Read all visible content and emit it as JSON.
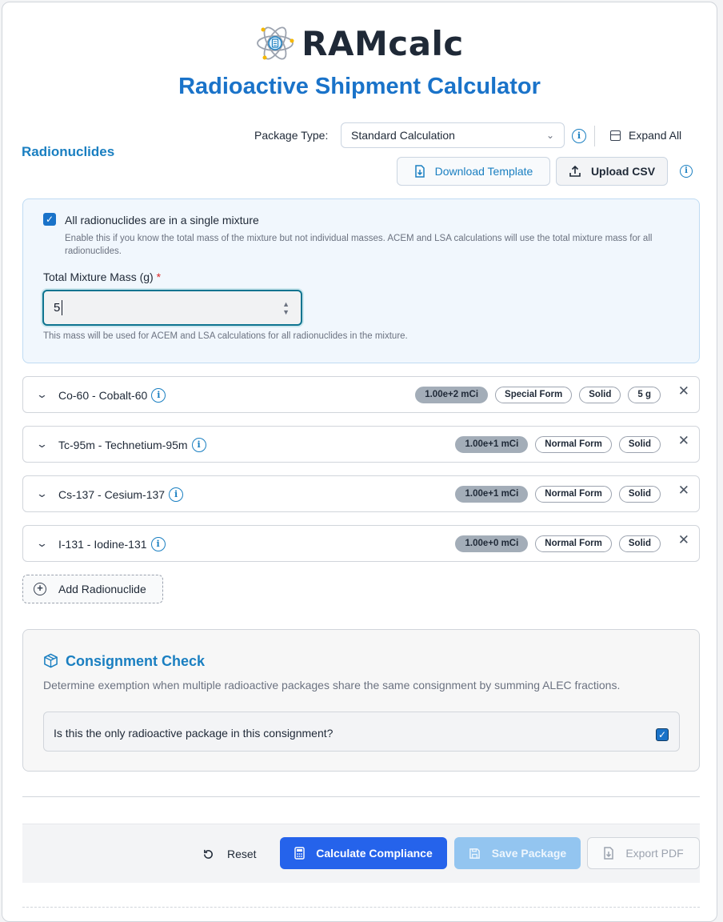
{
  "header": {
    "logo_text": "RAMcalc",
    "title": "Radioactive Shipment Calculator"
  },
  "radionuclides": {
    "section_title": "Radionuclides",
    "package_type_label": "Package Type:",
    "package_type_value": "Standard Calculation",
    "expand_all_label": "Expand All",
    "download_template_label": "Download Template",
    "upload_csv_label": "Upload CSV"
  },
  "mixture": {
    "checked": true,
    "checkbox_label": "All radionuclides are in a single mixture",
    "help": "Enable this if you know the total mass of the mixture but not individual masses. ACEM and LSA calculations will use the total mixture mass for all radionuclides.",
    "mass_label": "Total Mixture Mass (g)",
    "required_mark": "*",
    "mass_value": "5",
    "mass_help": "This mass will be used for ACEM and LSA calculations for all radionuclides in the mixture."
  },
  "nuclides": [
    {
      "name": "Co-60 - Cobalt-60",
      "activity": "1.00e+2 mCi",
      "form": "Special Form",
      "state": "Solid",
      "mass": "5 g"
    },
    {
      "name": "Tc-95m - Technetium-95m",
      "activity": "1.00e+1 mCi",
      "form": "Normal Form",
      "state": "Solid"
    },
    {
      "name": "Cs-137 - Cesium-137",
      "activity": "1.00e+1 mCi",
      "form": "Normal Form",
      "state": "Solid"
    },
    {
      "name": "I-131 - Iodine-131",
      "activity": "1.00e+0 mCi",
      "form": "Normal Form",
      "state": "Solid"
    }
  ],
  "add_radionuclide_label": "Add Radionuclide",
  "consignment": {
    "title": "Consignment Check",
    "description": "Determine exemption when multiple radioactive packages share the same consignment by summing ALEC fractions.",
    "question": "Is this the only radioactive package in this consignment?",
    "checked": true
  },
  "actions": {
    "reset_label": "Reset",
    "calculate_label": "Calculate Compliance",
    "save_label": "Save Package",
    "export_label": "Export PDF"
  },
  "colors": {
    "accent": "#1a7fc1",
    "primary_button": "#2563eb",
    "disabled_button": "#93c5f0",
    "activity_badge": "#a3adb8"
  }
}
